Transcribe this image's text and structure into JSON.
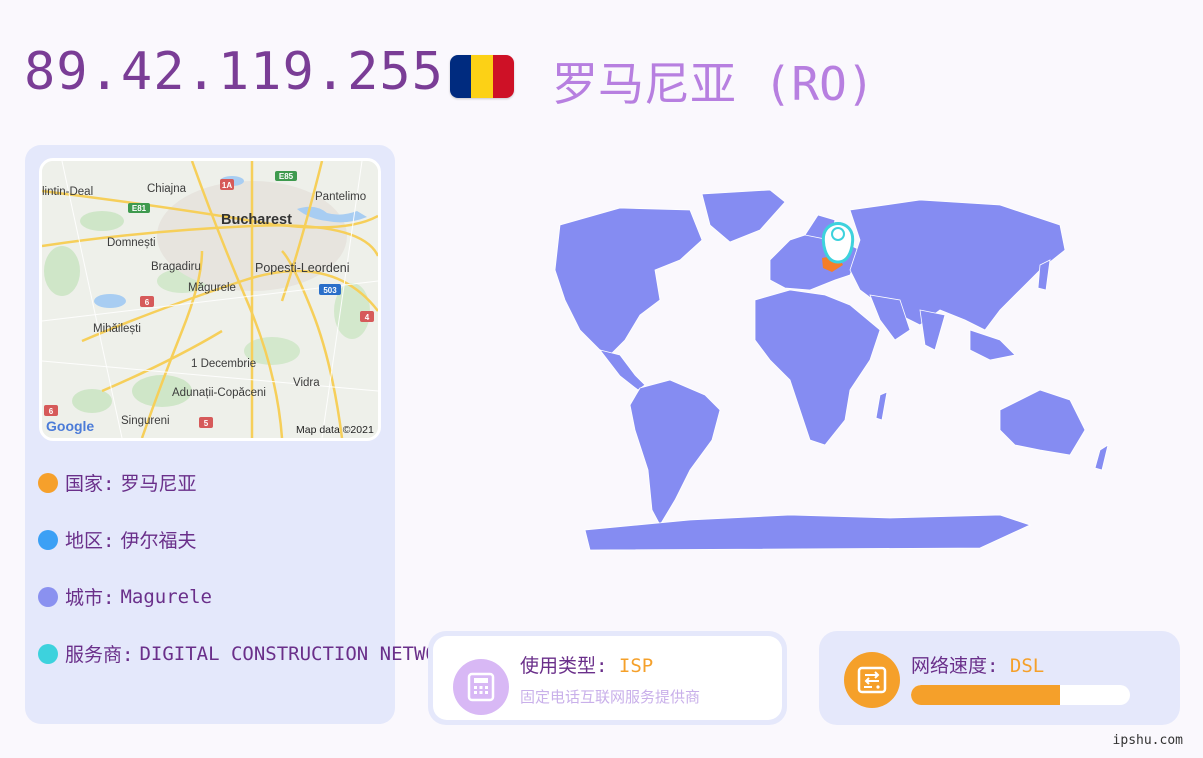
{
  "header": {
    "ip": "89.42.119.255",
    "country_title": "罗马尼亚 (RO)",
    "flag_colors": [
      "#002b7f",
      "#fcd116",
      "#ce1126"
    ]
  },
  "mini_map": {
    "labels": {
      "clintin_deal": "lintin-Deal",
      "chiajna": "Chiajna",
      "pantelimon": "Pantelimo",
      "bucharest": "Bucharest",
      "domnesti": "Domnești",
      "bragadiru": "Bragadiru",
      "popesti": "Popesti-Leordeni",
      "magurele": "Măgurele",
      "mihailesti": "Mihăilești",
      "decembrie": "1 Decembrie",
      "adunatii": "Adunații-Copăceni",
      "vidra": "Vidra",
      "singureni": "Singureni",
      "attribution": "Map data ©2021",
      "brand": "Google"
    },
    "shields": {
      "a1": "1A",
      "e85": "E85",
      "e81": "E81",
      "r6a": "6",
      "r503": "503",
      "r4": "4",
      "r6b": "6",
      "r5": "5"
    }
  },
  "info": {
    "country": {
      "label": "国家:",
      "value": "罗马尼亚",
      "color": "#f6a02b"
    },
    "region": {
      "label": "地区:",
      "value": "伊尔福夫",
      "color": "#3ba0f5"
    },
    "city": {
      "label": "城市:",
      "value": "Magurele",
      "color": "#8a91f0"
    },
    "isp": {
      "label": "服务商:",
      "value": "DIGITAL CONSTRUCTION NETWORK",
      "color": "#3dd2dd"
    }
  },
  "usage": {
    "title": "使用类型:",
    "value": "ISP",
    "subtitle": "固定电话互联网服务提供商",
    "icon": "phone-icon",
    "icon_color": "#d8b8f5"
  },
  "speed": {
    "title": "网络速度:",
    "value": "DSL",
    "progress": 0.68,
    "icon": "router-icon",
    "icon_color": "#f5a02a"
  },
  "footer": {
    "site": "ipshu.com"
  },
  "colors": {
    "world_land": "#858cf2",
    "highlight": "#f57d2a",
    "pin": "#3dd2dd"
  }
}
